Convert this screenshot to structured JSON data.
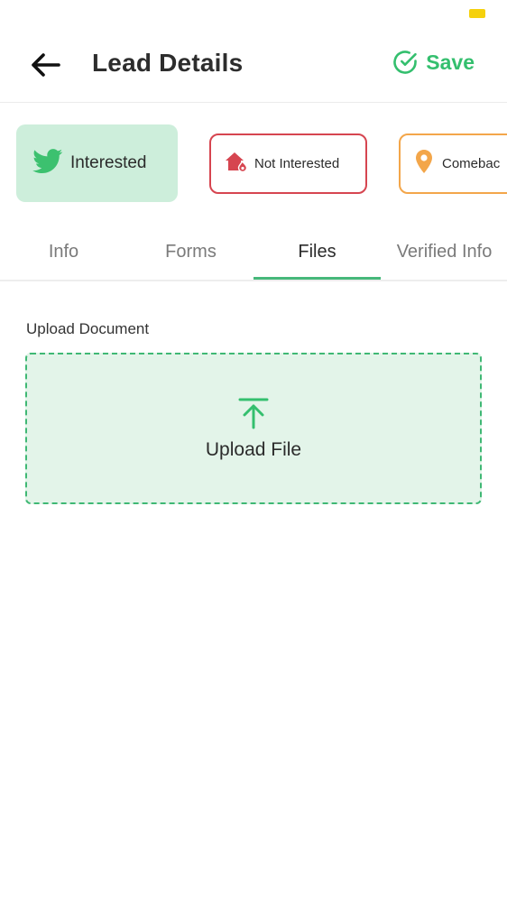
{
  "header": {
    "title": "Lead Details",
    "save_label": "Save",
    "back_icon": "back-arrow-icon",
    "save_icon": "check-circle-icon"
  },
  "status_chips": [
    {
      "label": "Interested",
      "icon": "twitter-bird-icon",
      "selected": true
    },
    {
      "label": "Not Interested",
      "icon": "house-fire-icon",
      "selected": false
    },
    {
      "label": "Comebac",
      "icon": "location-pin-icon",
      "selected": false
    }
  ],
  "tabs": [
    {
      "label": "Info",
      "active": false
    },
    {
      "label": "Forms",
      "active": false
    },
    {
      "label": "Files",
      "active": true
    },
    {
      "label": "Verified Info",
      "active": false
    }
  ],
  "upload": {
    "section_label": "Upload Document",
    "button_label": "Upload File",
    "icon": "upload-arrow-icon"
  },
  "colors": {
    "accent": "#34bf6e",
    "interested_bg": "#cdeedb",
    "not_interested_border": "#d64550",
    "comeback_border": "#f3a64a",
    "upload_bg": "#e3f4e9",
    "battery": "#f5d10d"
  }
}
